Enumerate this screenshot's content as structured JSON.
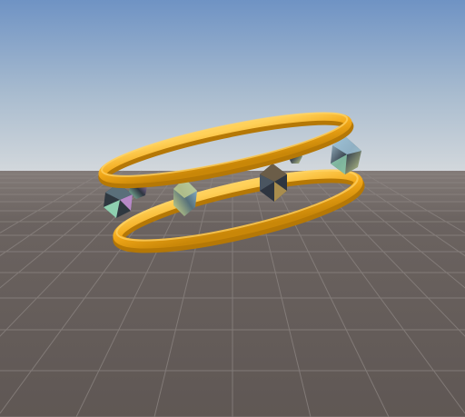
{
  "scene": {
    "sky_top": "#6f93c4",
    "sky_horizon": "#c9d3db",
    "ground_color": "#6b6360",
    "grid_color": "#8a8380",
    "ring_gold": "#f2a818",
    "ring_gold_dark": "#c98708",
    "ring_gold_light": "#ffc84a",
    "gem_colors": [
      "#3a3a4a",
      "#5a6f7a",
      "#8fb6a0",
      "#a77fb8",
      "#c4cf8e",
      "#2f3840",
      "#9fc3d8"
    ]
  }
}
